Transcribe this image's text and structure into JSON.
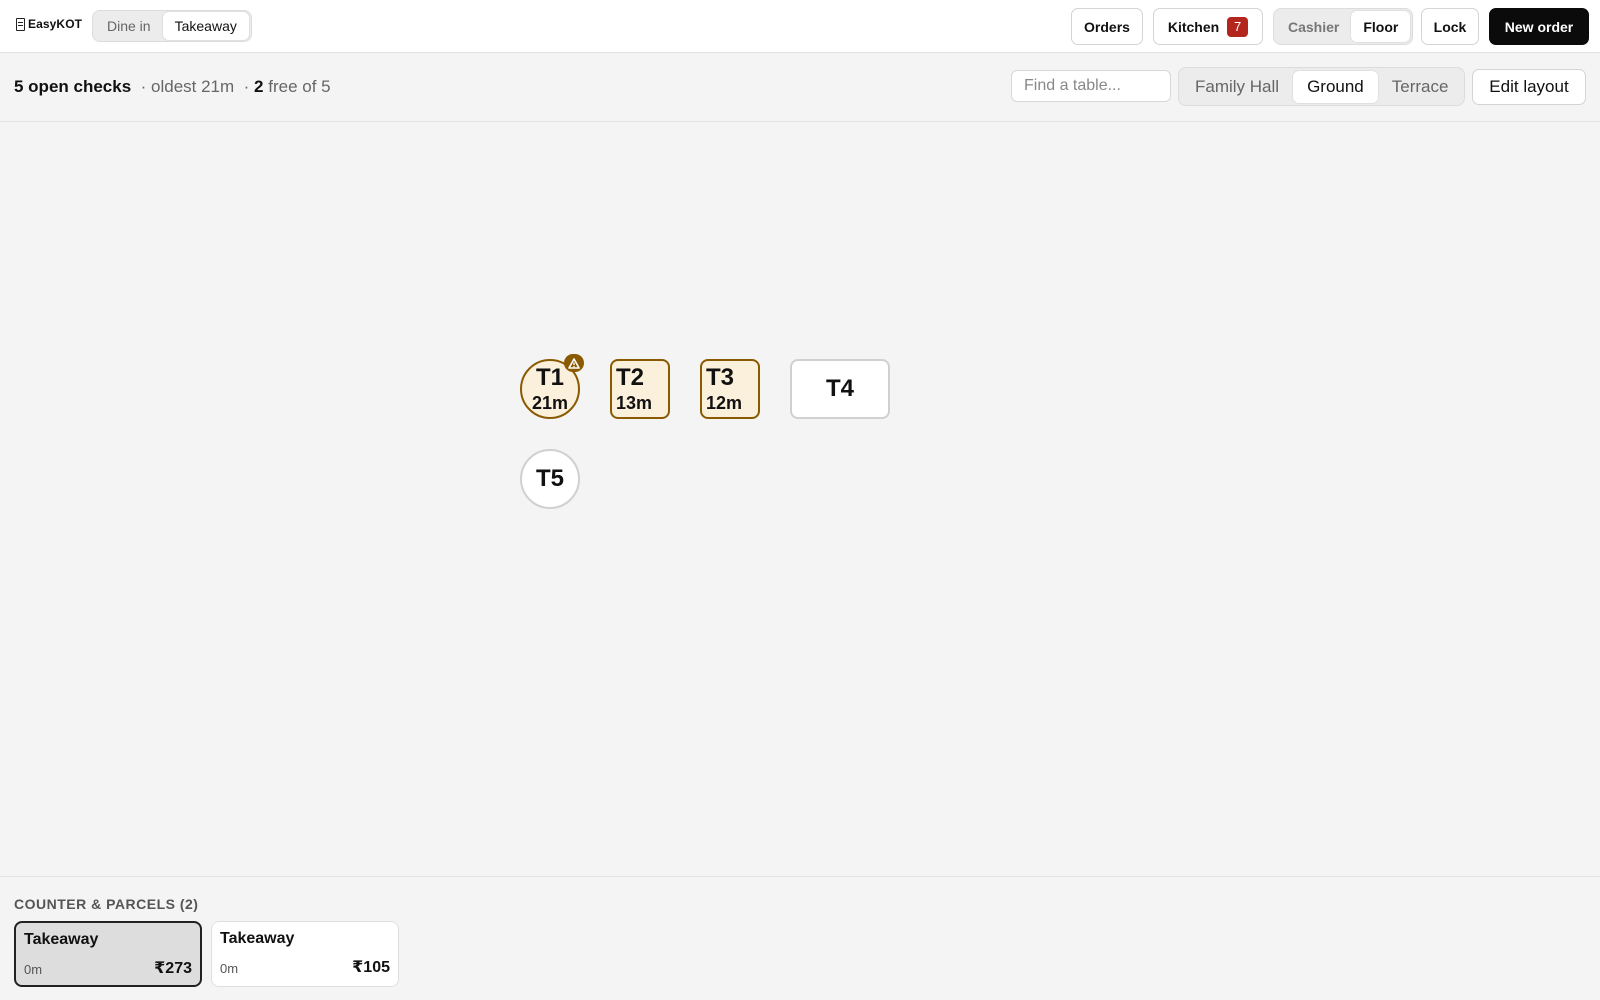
{
  "brand": {
    "name": "EasyKOT"
  },
  "header": {
    "modes": [
      "Dine in",
      "Takeaway"
    ],
    "orders_label": "Orders",
    "kitchen_label": "Kitchen",
    "kitchen_count": "7",
    "roles": [
      "Cashier",
      "Floor"
    ],
    "lock_label": "Lock",
    "new_order_label": "New order"
  },
  "summary": {
    "open_checks": "5 open checks",
    "oldest": "· oldest 21m",
    "sep": "·",
    "free_count": "2",
    "free_text": "free of 5"
  },
  "search": {
    "placeholder": "Find a table..."
  },
  "floors": [
    "Family Hall",
    "Ground",
    "Terrace"
  ],
  "edit_layout_label": "Edit layout",
  "tables": [
    {
      "name": "T1",
      "time": "21m",
      "status": "busy",
      "alert": true
    },
    {
      "name": "T2",
      "time": "13m",
      "status": "busy"
    },
    {
      "name": "T3",
      "time": "12m",
      "status": "busy"
    },
    {
      "name": "T4",
      "time": "",
      "status": "free"
    },
    {
      "name": "T5",
      "time": "",
      "status": "free"
    }
  ],
  "colors": {
    "busy_border": "#8a5a00",
    "busy_fill": "#fbf0dc",
    "kitchen_badge": "#b3261e"
  },
  "parcels": {
    "title": "COUNTER & PARCELS (2)",
    "items": [
      {
        "name": "Takeaway",
        "time": "0m",
        "amount": "₹273"
      },
      {
        "name": "Takeaway",
        "time": "0m",
        "amount": "₹105"
      }
    ]
  }
}
